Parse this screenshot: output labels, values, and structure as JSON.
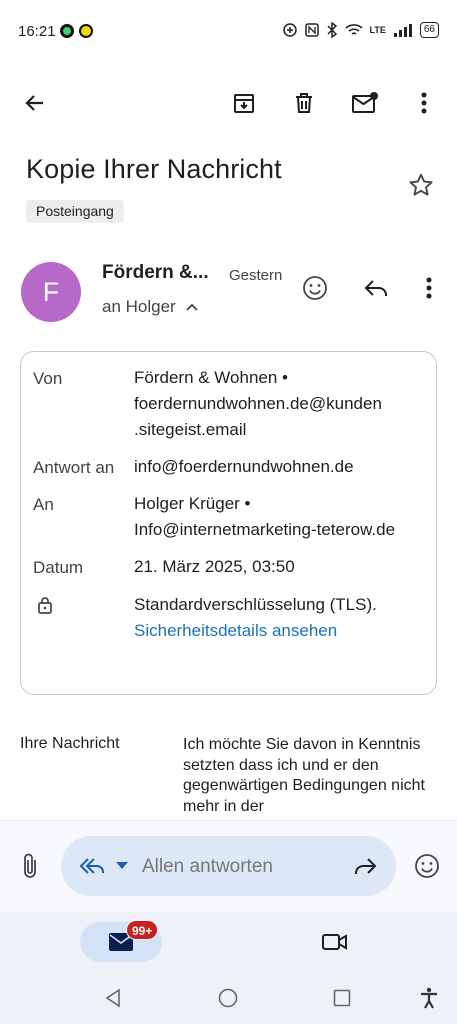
{
  "status_bar": {
    "time": "16:21",
    "network": "LTE",
    "battery": "66"
  },
  "app_bar": {
    "back_icon": "arrow-back-icon",
    "archive_icon": "archive-icon",
    "delete_icon": "delete-icon",
    "mark_unread_icon": "mark-unread-icon",
    "more_icon": "more-vert-icon"
  },
  "email": {
    "subject": "Kopie Ihrer Nachricht",
    "label": "Posteingang",
    "sender_initial": "F",
    "sender_short": "Fördern &...",
    "date": "Gestern",
    "recipient_line": "an Holger"
  },
  "details": {
    "from_label": "Von",
    "from_line1": "Fördern & Wohnen •",
    "from_line2": "foerdernundwohnen.de@kunden",
    "from_line3": ".sitegeist.email",
    "reply_to_label": "Antwort an",
    "reply_to_value": "info@foerdernundwohnen.de",
    "to_label": "An",
    "to_line1": "Holger Krüger •",
    "to_line2": "Info@internetmarketing-teterow.de",
    "date_label": "Datum",
    "date_value": "21. März 2025, 03:50",
    "encryption_value": "Standardverschlüsselung (TLS).",
    "security_link": "Sicherheitsdetails ansehen"
  },
  "body": {
    "label": "Ihre Nachricht",
    "text": "Ich möchte Sie davon in Kenntnis setzten dass ich und er den gegenwärtigen Bedingungen nicht mehr in der"
  },
  "reply": {
    "placeholder": "Allen antworten"
  },
  "bottom_nav": {
    "mail_badge": "99+"
  },
  "colors": {
    "avatar": "#b769c9",
    "link": "#1a73b8",
    "reply_field": "#dde8f6",
    "badge": "#c5221f"
  }
}
